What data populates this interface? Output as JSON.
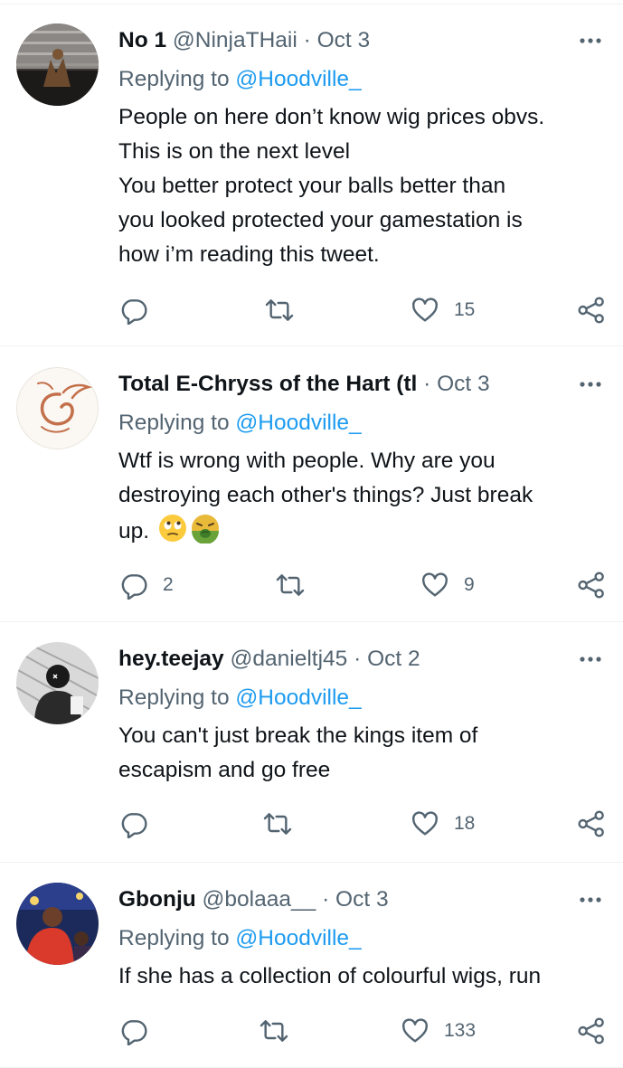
{
  "colors": {
    "accent": "#1d9bf0",
    "secondary_text": "#536471",
    "divider": "#eff3f4"
  },
  "tweets": [
    {
      "name": "No 1",
      "handle": "@NinjaTHaii",
      "date": "Oct 3",
      "replying_label": "Replying to ",
      "replying_to": "@Hoodville_",
      "lines": [
        "People on here don’t know wig prices obvs.",
        "This is on the next level",
        "You better protect your balls better than",
        "you looked protected your gamestation is",
        "how i’m reading this tweet."
      ],
      "replies": "",
      "retweets": "",
      "likes": "15"
    },
    {
      "name": "Total E-Chryss of the Hart (tl",
      "handle": "",
      "date": "Oct 3",
      "replying_label": "Replying to ",
      "replying_to": "@Hoodville_",
      "lines": [
        "Wtf is wrong with people. Why are you",
        "destroying each other's things? Just break",
        "up."
      ],
      "emojis": [
        "face-with-rolling-eyes",
        "nauseated-face"
      ],
      "replies": "2",
      "retweets": "",
      "likes": "9"
    },
    {
      "name": "hey.teejay",
      "handle": "@danieltj45",
      "date": "Oct 2",
      "replying_label": "Replying to ",
      "replying_to": "@Hoodville_",
      "lines": [
        "You can't just break the kings item of",
        "escapism and go free"
      ],
      "replies": "",
      "retweets": "",
      "likes": "18"
    },
    {
      "name": "Gbonju",
      "handle": "@bolaaa__",
      "date": "Oct 3",
      "replying_label": "Replying to ",
      "replying_to": "@Hoodville_",
      "lines": [
        "If she has a collection of colourful wigs, run"
      ],
      "replies": "",
      "retweets": "",
      "likes": "133"
    }
  ]
}
